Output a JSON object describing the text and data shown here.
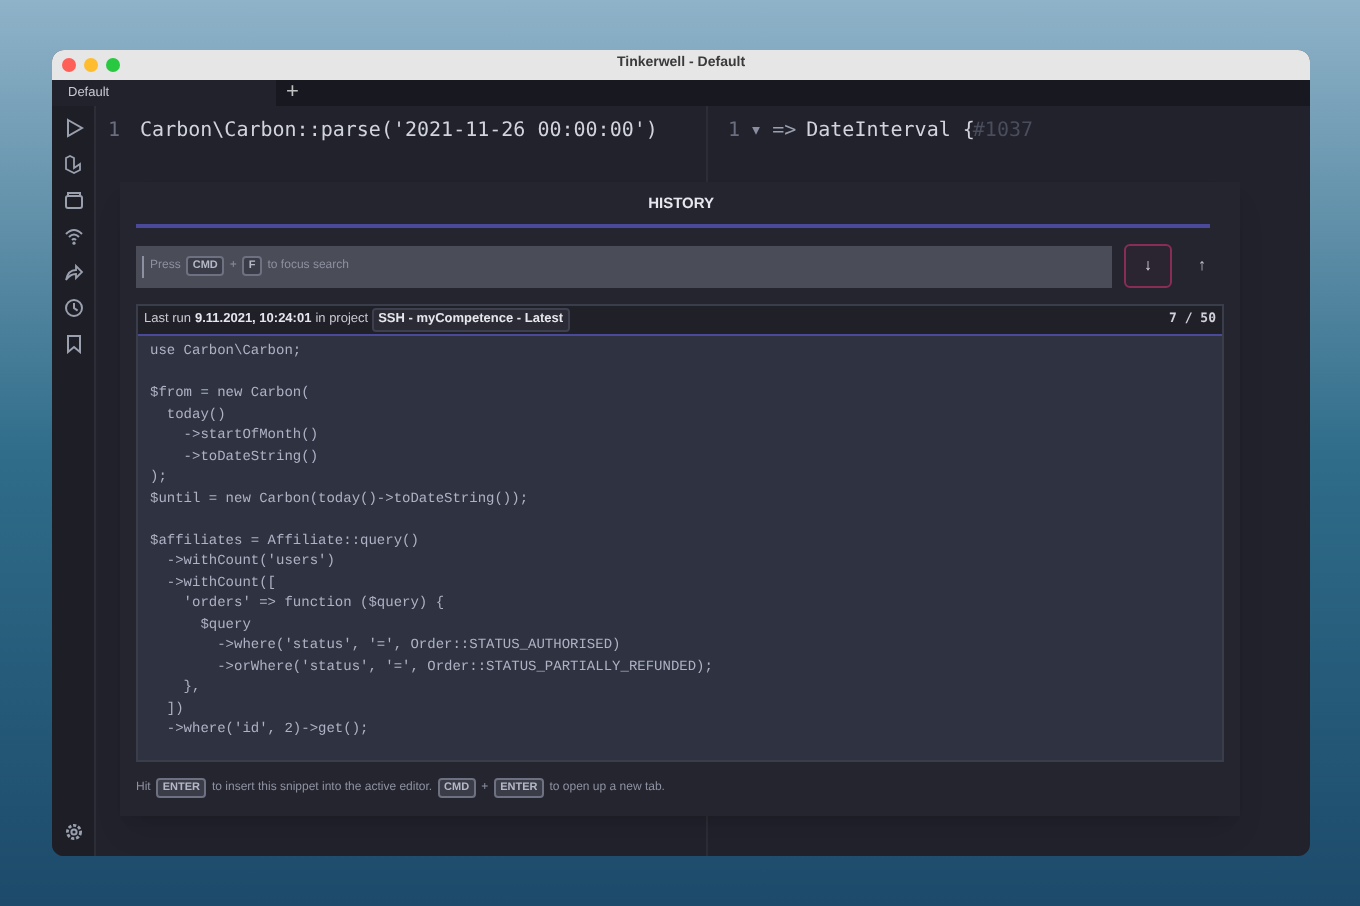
{
  "window": {
    "title": "Tinkerwell - Default"
  },
  "tabs": [
    {
      "label": "Default",
      "selected": true
    }
  ],
  "new_tab": "+",
  "editor": {
    "line_number": "1",
    "code": "Carbon\\Carbon::parse('2021-11-26 00:00:00')"
  },
  "output": {
    "line_number": "1",
    "fold": "▾",
    "arrow": "=>",
    "text": "DateInterval {",
    "ref": "#1037"
  },
  "history": {
    "title": "HISTORY",
    "search_hint": [
      {
        "kind": "text",
        "text": "Press"
      },
      {
        "kind": "key",
        "text": "CMD"
      },
      {
        "kind": "text",
        "text": "+"
      },
      {
        "kind": "key",
        "text": "F"
      },
      {
        "kind": "text",
        "text": "to focus search"
      }
    ],
    "buttons": [
      {
        "glyph": "↓",
        "selected": true
      },
      {
        "glyph": "↑",
        "selected": false
      }
    ],
    "entry": {
      "last_run_label": "Last run",
      "date": "9.11.2021, 10:24:01",
      "in_project": "in project",
      "project": "SSH - myCompetence - Latest",
      "position": "7 / 50",
      "lines": [
        {
          "kind": "code",
          "text": "use Carbon\\Carbon;"
        },
        {
          "kind": "blank"
        },
        {
          "kind": "code",
          "text": "$from = new Carbon("
        },
        {
          "kind": "code",
          "text": "  today()"
        },
        {
          "kind": "code",
          "text": "    ->startOfMonth()"
        },
        {
          "kind": "code",
          "text": "    ->toDateString()"
        },
        {
          "kind": "code",
          "text": ");"
        },
        {
          "kind": "code",
          "text": "$until = new Carbon(today()->toDateString());"
        },
        {
          "kind": "blank"
        },
        {
          "kind": "code",
          "text": "$affiliates = Affiliate::query()"
        },
        {
          "kind": "code",
          "text": "  ->withCount('users')"
        },
        {
          "kind": "code",
          "text": "  ->withCount(["
        },
        {
          "kind": "code",
          "text": "    'orders' => function ($query) {"
        },
        {
          "kind": "code",
          "text": "      $query"
        },
        {
          "kind": "code",
          "text": "        ->where('status', '=', Order::STATUS_AUTHORISED)"
        },
        {
          "kind": "code",
          "text": "        ->orWhere('status', '=', Order::STATUS_PARTIALLY_REFUNDED);"
        },
        {
          "kind": "code",
          "text": "    },"
        },
        {
          "kind": "code",
          "text": "  ])"
        },
        {
          "kind": "code",
          "text": "  ->where('id', 2)->get();"
        }
      ]
    },
    "footer": [
      {
        "kind": "text",
        "text": "Hit"
      },
      {
        "kind": "key",
        "text": "ENTER"
      },
      {
        "kind": "text",
        "text": "to insert this snippet into the active editor."
      },
      {
        "kind": "key",
        "text": "CMD"
      },
      {
        "kind": "text",
        "text": "+"
      },
      {
        "kind": "key",
        "text": "ENTER"
      },
      {
        "kind": "text",
        "text": "to open up a new tab."
      }
    ]
  }
}
